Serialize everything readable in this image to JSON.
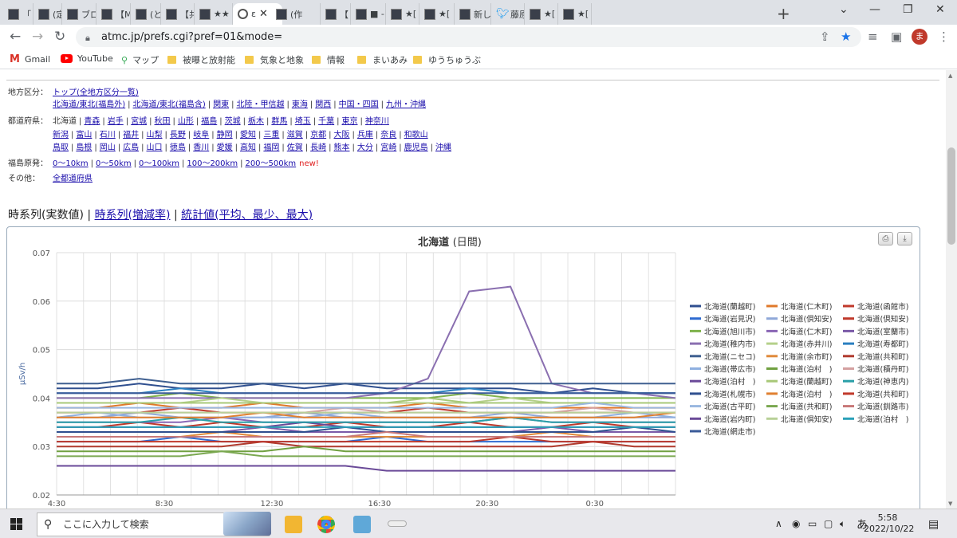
{
  "browser": {
    "tabs": [
      {
        "label": "「 ッ"
      },
      {
        "label": "(定"
      },
      {
        "label": "ブログ"
      },
      {
        "label": "【M"
      },
      {
        "label": "(と)"
      },
      {
        "label": "【共"
      },
      {
        "label": "★★"
      },
      {
        "label": "ε",
        "active": true
      },
      {
        "label": "(作"
      },
      {
        "label": "【 こ"
      },
      {
        "label": "■ -"
      },
      {
        "label": "★["
      },
      {
        "label": "★["
      },
      {
        "label": "新し"
      },
      {
        "label": "藤原"
      },
      {
        "label": "★["
      },
      {
        "label": "★["
      }
    ],
    "new_tab": "+",
    "url": "atmc.jp/prefs.cgi?pref=01&mode=",
    "avatar_letter": "ま",
    "bookmarks": [
      "Gmail",
      "YouTube",
      "マップ",
      "被曝と放射能",
      "気象と地象",
      "情報",
      "まいあみ",
      "ゆうちゅうぶ"
    ]
  },
  "page": {
    "region_label": "地方区分：",
    "region_top_link": "トップ(全地方区分一覧)",
    "regions": [
      "北海道/東北(福島外)",
      "北海道/東北(福島含)",
      "関東",
      "北陸・甲信越",
      "東海",
      "関西",
      "中国・四国",
      "九州・沖縄"
    ],
    "pref_label": "都道府県：",
    "pref_current": "北海道",
    "prefs_row1": [
      "青森",
      "岩手",
      "宮城",
      "秋田",
      "山形",
      "福島",
      "茨城",
      "栃木",
      "群馬",
      "埼玉",
      "千葉",
      "東京",
      "神奈川"
    ],
    "prefs_row2": [
      "新潟",
      "富山",
      "石川",
      "福井",
      "山梨",
      "長野",
      "岐阜",
      "静岡",
      "愛知",
      "三重",
      "滋賀",
      "京都",
      "大阪",
      "兵庫",
      "奈良",
      "和歌山"
    ],
    "prefs_row3": [
      "鳥取",
      "島根",
      "岡山",
      "広島",
      "山口",
      "徳島",
      "香川",
      "愛媛",
      "高知",
      "福岡",
      "佐賀",
      "長崎",
      "熊本",
      "大分",
      "宮崎",
      "鹿児島",
      "沖縄"
    ],
    "fukushima_label": "福島原発：",
    "fukushima_links": [
      "0～10km",
      "0～50km",
      "0～100km",
      "100～200km",
      "200～500km"
    ],
    "new_badge": "new!",
    "other_label": "その他：",
    "other_link": "全都道府県",
    "view_current": "時系列(実数値)",
    "view_links": [
      "時系列(増減率)",
      "統計値(平均、最少、最大)"
    ],
    "view_sep": "|"
  },
  "chart_data": {
    "type": "line",
    "title": "北海道",
    "subtitle": "(日間)",
    "ylabel": "μSv/h",
    "ylim": [
      0.02,
      0.07
    ],
    "yticks": [
      "0.07",
      "0.06",
      "0.05",
      "0.04",
      "0.03",
      "0.02"
    ],
    "xticks": [
      "4:30",
      "8:30",
      "12:30",
      "16:30",
      "20:30",
      "0:30"
    ],
    "series": [
      {
        "name": "北海道(蘭越町)",
        "color": "#2f4f8f",
        "values": [
          0.042,
          0.042,
          0.043,
          0.042,
          0.042,
          0.043,
          0.042,
          0.043,
          0.042,
          0.042,
          0.042,
          0.042,
          0.041,
          0.042,
          0.041,
          0.041
        ]
      },
      {
        "name": "北海道(仁木町)",
        "color": "#e0782a",
        "values": [
          0.038,
          0.038,
          0.039,
          0.038,
          0.038,
          0.039,
          0.038,
          0.038,
          0.038,
          0.039,
          0.038,
          0.038,
          0.038,
          0.038,
          0.038,
          0.038
        ]
      },
      {
        "name": "北海道(函館市)",
        "color": "#c0392b",
        "values": [
          0.034,
          0.034,
          0.035,
          0.034,
          0.035,
          0.034,
          0.034,
          0.035,
          0.034,
          0.034,
          0.035,
          0.034,
          0.034,
          0.035,
          0.034,
          0.034
        ]
      },
      {
        "name": "北海道(岩見沢)",
        "color": "#2f6bd1",
        "values": [
          0.031,
          0.031,
          0.031,
          0.032,
          0.031,
          0.031,
          0.031,
          0.031,
          0.032,
          0.031,
          0.031,
          0.031,
          0.031,
          0.031,
          0.031,
          0.031
        ]
      },
      {
        "name": "北海道(倶知安)",
        "color": "#8fa8d8",
        "values": [
          0.036,
          0.036,
          0.037,
          0.036,
          0.036,
          0.036,
          0.037,
          0.036,
          0.036,
          0.036,
          0.036,
          0.037,
          0.036,
          0.036,
          0.036,
          0.036
        ]
      },
      {
        "name": "北海道(倶知安)",
        "color": "#c0392b",
        "values": [
          0.037,
          0.037,
          0.037,
          0.038,
          0.037,
          0.037,
          0.037,
          0.037,
          0.037,
          0.038,
          0.037,
          0.037,
          0.037,
          0.037,
          0.037,
          0.037
        ]
      },
      {
        "name": "北海道(旭川市)",
        "color": "#7fb24c",
        "values": [
          0.04,
          0.04,
          0.04,
          0.041,
          0.04,
          0.04,
          0.04,
          0.04,
          0.04,
          0.04,
          0.041,
          0.04,
          0.04,
          0.04,
          0.04,
          0.04
        ]
      },
      {
        "name": "北海道(仁木町)",
        "color": "#8a66b5",
        "values": [
          0.035,
          0.035,
          0.035,
          0.035,
          0.036,
          0.035,
          0.035,
          0.035,
          0.035,
          0.035,
          0.035,
          0.036,
          0.035,
          0.035,
          0.035,
          0.035
        ]
      },
      {
        "name": "北海道(室蘭市)",
        "color": "#7a5aa8",
        "values": [
          0.033,
          0.033,
          0.033,
          0.033,
          0.033,
          0.034,
          0.033,
          0.033,
          0.033,
          0.033,
          0.033,
          0.033,
          0.034,
          0.033,
          0.033,
          0.033
        ]
      },
      {
        "name": "北海道(稚内市)",
        "color": "#8a6fb0",
        "values": [
          0.04,
          0.04,
          0.04,
          0.04,
          0.04,
          0.04,
          0.04,
          0.04,
          0.041,
          0.044,
          0.062,
          0.063,
          0.043,
          0.041,
          0.041,
          0.04
        ]
      },
      {
        "name": "北海道(赤井川)",
        "color": "#b5d08a",
        "values": [
          0.039,
          0.039,
          0.039,
          0.039,
          0.04,
          0.039,
          0.039,
          0.039,
          0.039,
          0.039,
          0.039,
          0.04,
          0.039,
          0.039,
          0.039,
          0.039
        ]
      },
      {
        "name": "北海道(寿都町)",
        "color": "#2a7fc0",
        "values": [
          0.041,
          0.041,
          0.041,
          0.042,
          0.041,
          0.041,
          0.041,
          0.041,
          0.041,
          0.041,
          0.042,
          0.041,
          0.041,
          0.041,
          0.041,
          0.041
        ]
      },
      {
        "name": "北海道(ニセコ)",
        "color": "#3f5f90",
        "values": [
          0.043,
          0.043,
          0.044,
          0.043,
          0.043,
          0.043,
          0.043,
          0.043,
          0.043,
          0.043,
          0.043,
          0.043,
          0.043,
          0.043,
          0.043,
          0.043
        ]
      },
      {
        "name": "北海道(余市町)",
        "color": "#e08a3a",
        "values": [
          0.032,
          0.032,
          0.032,
          0.032,
          0.033,
          0.032,
          0.032,
          0.032,
          0.032,
          0.032,
          0.032,
          0.032,
          0.033,
          0.032,
          0.032,
          0.032
        ]
      },
      {
        "name": "北海道(共和町)",
        "color": "#b03a2e",
        "values": [
          0.03,
          0.03,
          0.03,
          0.03,
          0.03,
          0.031,
          0.03,
          0.03,
          0.03,
          0.03,
          0.03,
          0.03,
          0.03,
          0.031,
          0.03,
          0.03
        ]
      },
      {
        "name": "北海道(帯広市)",
        "color": "#8fb0e0",
        "values": [
          0.036,
          0.037,
          0.036,
          0.036,
          0.036,
          0.036,
          0.036,
          0.037,
          0.036,
          0.036,
          0.036,
          0.036,
          0.036,
          0.036,
          0.037,
          0.036
        ]
      },
      {
        "name": "北海道(泊村　)",
        "color": "#70a040",
        "values": [
          0.029,
          0.029,
          0.029,
          0.029,
          0.029,
          0.029,
          0.03,
          0.029,
          0.029,
          0.029,
          0.029,
          0.029,
          0.029,
          0.029,
          0.029,
          0.029
        ]
      },
      {
        "name": "北海道(積丹町)",
        "color": "#d4a0a0",
        "values": [
          0.037,
          0.037,
          0.037,
          0.037,
          0.037,
          0.037,
          0.037,
          0.038,
          0.037,
          0.037,
          0.037,
          0.037,
          0.037,
          0.038,
          0.037,
          0.037
        ]
      },
      {
        "name": "北海道(泊村　)",
        "color": "#6a4a98",
        "values": [
          0.034,
          0.034,
          0.034,
          0.034,
          0.034,
          0.034,
          0.035,
          0.034,
          0.034,
          0.034,
          0.034,
          0.034,
          0.034,
          0.034,
          0.034,
          0.034
        ]
      },
      {
        "name": "北海道(蘭越町)",
        "color": "#a8c878",
        "values": [
          0.039,
          0.039,
          0.039,
          0.039,
          0.039,
          0.039,
          0.039,
          0.039,
          0.039,
          0.04,
          0.039,
          0.039,
          0.039,
          0.039,
          0.039,
          0.039
        ]
      },
      {
        "name": "北海道(神恵内)",
        "color": "#2aa0a8",
        "values": [
          0.035,
          0.035,
          0.035,
          0.036,
          0.035,
          0.035,
          0.035,
          0.035,
          0.035,
          0.035,
          0.035,
          0.036,
          0.035,
          0.035,
          0.035,
          0.035
        ]
      },
      {
        "name": "北海道(札幌市)",
        "color": "#2f4f8f",
        "values": [
          0.033,
          0.033,
          0.033,
          0.033,
          0.033,
          0.033,
          0.033,
          0.034,
          0.033,
          0.033,
          0.033,
          0.033,
          0.033,
          0.033,
          0.034,
          0.033
        ]
      },
      {
        "name": "北海道(泊村　)",
        "color": "#e08030",
        "values": [
          0.036,
          0.036,
          0.036,
          0.036,
          0.036,
          0.037,
          0.036,
          0.036,
          0.036,
          0.036,
          0.036,
          0.036,
          0.036,
          0.036,
          0.036,
          0.037
        ]
      },
      {
        "name": "北海道(共和町)",
        "color": "#c0392b",
        "values": [
          0.031,
          0.031,
          0.031,
          0.031,
          0.031,
          0.031,
          0.031,
          0.031,
          0.031,
          0.031,
          0.031,
          0.032,
          0.031,
          0.031,
          0.031,
          0.031
        ]
      },
      {
        "name": "北海道(古平町)",
        "color": "#9ab8e0",
        "values": [
          0.038,
          0.038,
          0.038,
          0.038,
          0.038,
          0.038,
          0.038,
          0.038,
          0.038,
          0.038,
          0.038,
          0.038,
          0.038,
          0.039,
          0.038,
          0.038
        ]
      },
      {
        "name": "北海道(共和町)",
        "color": "#7aa850",
        "values": [
          0.028,
          0.028,
          0.028,
          0.028,
          0.029,
          0.028,
          0.028,
          0.028,
          0.028,
          0.028,
          0.028,
          0.028,
          0.028,
          0.028,
          0.028,
          0.028
        ]
      },
      {
        "name": "北海道(釧路市)",
        "color": "#c87878",
        "values": [
          0.032,
          0.032,
          0.032,
          0.032,
          0.032,
          0.032,
          0.032,
          0.032,
          0.033,
          0.032,
          0.032,
          0.032,
          0.032,
          0.032,
          0.032,
          0.032
        ]
      },
      {
        "name": "北海道(岩内町)",
        "color": "#6a4a98",
        "values": [
          0.026,
          0.026,
          0.026,
          0.026,
          0.026,
          0.026,
          0.026,
          0.026,
          0.025,
          0.025,
          0.025,
          0.025,
          0.025,
          0.025,
          0.025,
          0.025
        ]
      },
      {
        "name": "北海道(倶知安)",
        "color": "#b8d098",
        "values": [
          0.037,
          0.037,
          0.037,
          0.037,
          0.037,
          0.037,
          0.037,
          0.037,
          0.037,
          0.037,
          0.037,
          0.037,
          0.037,
          0.037,
          0.037,
          0.037
        ]
      },
      {
        "name": "北海道(泊村　)",
        "color": "#2aa0b8",
        "values": [
          0.034,
          0.034,
          0.034,
          0.034,
          0.034,
          0.034,
          0.034,
          0.034,
          0.034,
          0.034,
          0.034,
          0.034,
          0.034,
          0.034,
          0.034,
          0.034
        ]
      },
      {
        "name": "北海道(網走市)",
        "color": "#3a5a98",
        "values": [
          0.041,
          0.041,
          0.041,
          0.041,
          0.041,
          0.041,
          0.041,
          0.041,
          0.041,
          0.041,
          0.041,
          0.041,
          0.041,
          0.041,
          0.041,
          0.041
        ]
      }
    ],
    "grid": true,
    "legend_position": "right"
  },
  "taskbar": {
    "search_placeholder": "ここに入力して検索",
    "ime": "あ",
    "time": "5:58",
    "date": "2022/10/22"
  },
  "colors": {
    "link": "#1a0dab",
    "accent_star": "#1a73e8",
    "avatar": "#c0392b"
  }
}
